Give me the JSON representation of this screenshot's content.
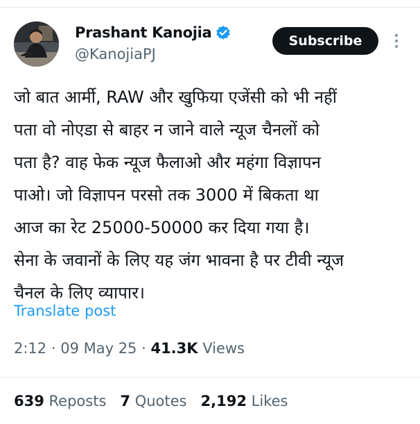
{
  "author": {
    "display_name": "Prashant Kanojia",
    "handle": "@KanojiaPJ",
    "verified": true
  },
  "subscribe_label": "Subscribe",
  "post": {
    "lines": [
      "जो बात आर्मी, RAW और खुफिया एजेंसी को भी नहीं",
      "पता वो नोएडा से बाहर न जाने वाले न्यूज चैनलों को",
      "पता है? वाह फेक न्यूज फैलाओ और महंगा विज्ञापन",
      "पाओ। जो विज्ञापन परसो तक 3000 में बिकता था",
      "आज का रेट 25000-50000 कर दिया गया है।",
      "सेना के जवानों के लिए यह जंग भावना है पर टीवी न्यूज",
      "चैनल के लिए व्यापार।"
    ],
    "translate_label": "Translate post"
  },
  "meta": {
    "time": "2:12",
    "sep1": " · ",
    "date": "09 May 25",
    "sep2": " · ",
    "views_count": "41.3K",
    "views_label": " Views"
  },
  "stats": {
    "reposts_count": "639",
    "reposts_label": "Reposts",
    "quotes_count": "7",
    "quotes_label": "Quotes",
    "likes_count": "2,192",
    "likes_label": "Likes"
  },
  "colors": {
    "link": "#1d9bf0",
    "muted": "#536471",
    "text": "#0f1419",
    "verified": "#1d9bf0"
  },
  "icons": {
    "verified": "verified-badge-icon",
    "more": "more-vertical-icon"
  }
}
